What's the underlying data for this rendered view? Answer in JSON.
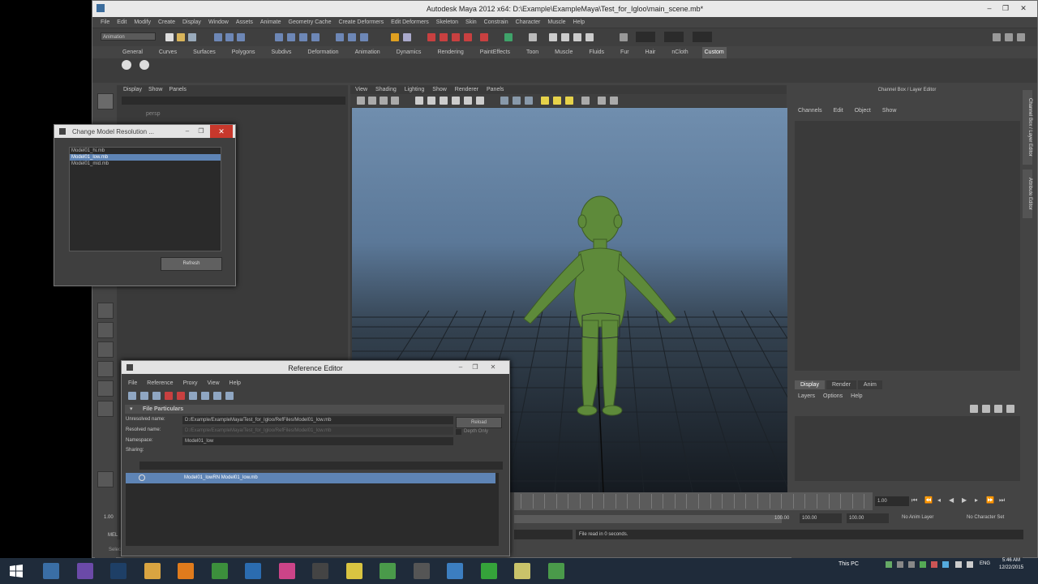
{
  "window": {
    "title": "Autodesk Maya 2012 x64: D:\\Example\\ExampleMaya\\Test_for_Igloo\\main_scene.mb*"
  },
  "menubar": [
    "File",
    "Edit",
    "Modify",
    "Create",
    "Display",
    "Window",
    "Assets",
    "Animate",
    "Geometry Cache",
    "Create Deformers",
    "Edit Deformers",
    "Skeleton",
    "Skin",
    "Constrain",
    "Character",
    "Muscle",
    "Help"
  ],
  "status_mode": "Animation",
  "shelf_tabs": [
    "General",
    "Curves",
    "Surfaces",
    "Polygons",
    "Subdivs",
    "Deformation",
    "Animation",
    "Dynamics",
    "Rendering",
    "PaintEffects",
    "Toon",
    "Muscle",
    "Fluids",
    "Fur",
    "Hair",
    "nCloth",
    "Custom"
  ],
  "shelf_active": "Custom",
  "outliner": {
    "menu": [
      "Display",
      "Show",
      "Panels"
    ],
    "item": "persp"
  },
  "viewport": {
    "menu": [
      "View",
      "Shading",
      "Lighting",
      "Show",
      "Renderer",
      "Panels"
    ]
  },
  "channel_box": {
    "header": "Channel Box / Layer Editor",
    "menu": [
      "Channels",
      "Edit",
      "Object",
      "Show"
    ]
  },
  "side_tabs": [
    "Channel Box / Layer Editor",
    "Attribute Editor"
  ],
  "layer_editor": {
    "tabs": [
      "Display",
      "Render",
      "Anim"
    ],
    "active_tab": "Display",
    "menu": [
      "Layers",
      "Options",
      "Help"
    ]
  },
  "time_slider": {
    "current": "1.00"
  },
  "range": {
    "start": "1.00",
    "end": "100.00",
    "end_range": "100.00",
    "anim_end": "100.00",
    "anim_layer": "No Anim Layer",
    "char_set": "No Character Set"
  },
  "command_line": {
    "label": "MEL",
    "result": "File read in 0 seconds."
  },
  "help_line": "Select",
  "change_model_dialog": {
    "title": "Change Model Resolution ...",
    "files": [
      "Model01_hi.mb",
      "Model01_low.mb",
      "Model01_mid.mb"
    ],
    "selected": 1,
    "refresh_label": "Refresh"
  },
  "reference_editor": {
    "title": "Reference Editor",
    "menu": [
      "File",
      "Reference",
      "Proxy",
      "View",
      "Help"
    ],
    "section": "File Particulars",
    "fields": [
      {
        "label": "Unresolved name:",
        "value": "D:/Example/ExampleMaya/Test_for_Igloo/RefFiles/Model01_low.mb"
      },
      {
        "label": "Resolved name:",
        "value": "D:/Example/ExampleMaya/Test_for_Igloo/RefFiles/Model01_low.mb"
      },
      {
        "label": "Namespace:",
        "value": "Model01_low"
      },
      {
        "label": "Sharing:",
        "value": ""
      }
    ],
    "reload_label": "Reload",
    "depth_label": "Depth Only",
    "tree_item": "Model01_lowRN Model01_low.mb"
  },
  "taskbar": {
    "apps": [
      "file-explorer",
      "visual-studio",
      "photoshop",
      "file-manager",
      "blender",
      "chrome",
      "word-pad",
      "itunes",
      "maya",
      "folder",
      "mudbox",
      "notepad",
      "drive",
      "line",
      "sticky",
      "igloo"
    ],
    "tray": {
      "label": "This PC",
      "lang": "ENG",
      "time": "5:46 AM",
      "date": "12/22/2015"
    }
  },
  "colors": {
    "accent": "#5e84b5",
    "close": "#c7382c",
    "taskbar": "#1f2b3a",
    "character": "#5e8a3a"
  }
}
